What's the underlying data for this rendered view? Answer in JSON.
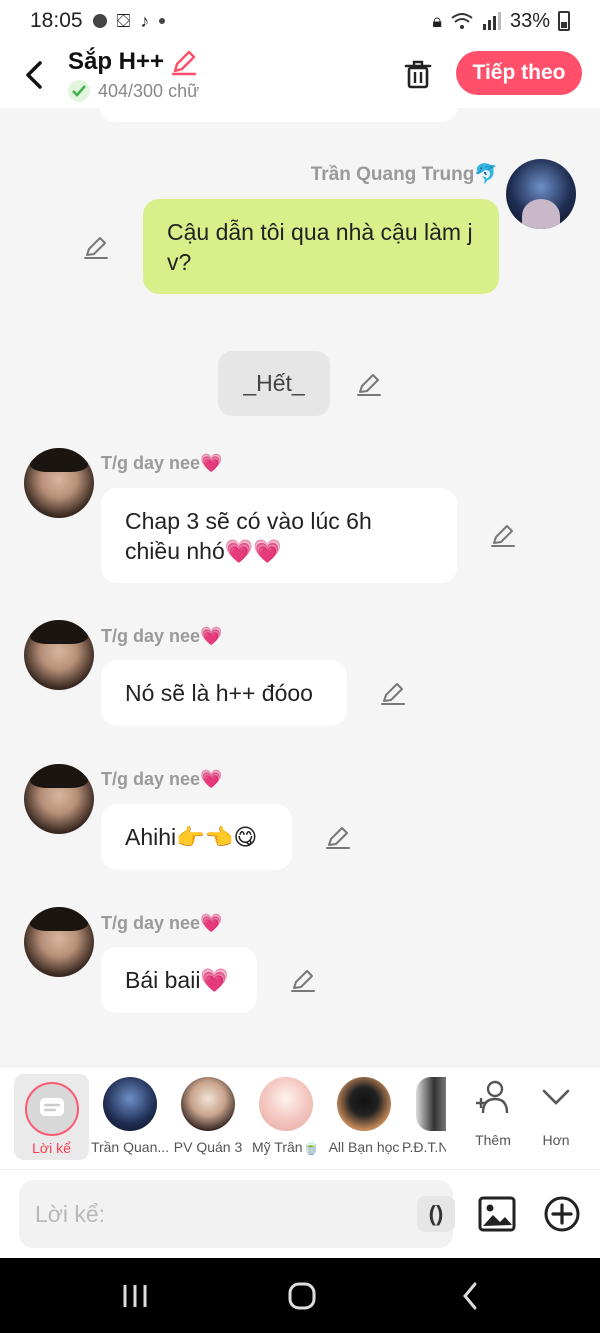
{
  "status_bar": {
    "time": "18:05",
    "battery": "33%"
  },
  "header": {
    "title": "Sắp H++",
    "word_count": "404/300 chữ",
    "next_label": "Tiếp theo"
  },
  "chat": {
    "right_message": {
      "name": "Trần Quang Trung🐬",
      "text": "Cậu dẫn tôi qua nhà cậu làm j v?"
    },
    "end_marker": "_Hết_",
    "left_messages": [
      {
        "name": "T/g day nee💗",
        "text": "Chap 3 sẽ có vào lúc 6h chiều nhó💗💗"
      },
      {
        "name": "T/g day nee💗",
        "text": "Nó sẽ là h++ đóoo"
      },
      {
        "name": "T/g day nee💗",
        "text": "Ahihi👉👈😋"
      },
      {
        "name": "T/g day nee💗",
        "text": "Bái baii💗"
      }
    ]
  },
  "characters": {
    "narrator_label": "Lời kể",
    "items": [
      {
        "label": "Trần Quan...",
        "color": "#1f2d52"
      },
      {
        "label": "PV Quán 3",
        "color": "#6b4a3a"
      },
      {
        "label": "Mỹ Trân🍵",
        "color": "#f3c7c0"
      },
      {
        "label": "All Bạn học",
        "color": "#8a5a3a"
      },
      {
        "label": "P.Đ.T.N",
        "color": "#555555"
      }
    ],
    "add_label": "Thêm",
    "more_label": "Hơn"
  },
  "input": {
    "placeholder": "Lời kể:",
    "paren_label": "()"
  },
  "colors": {
    "accent": "#ff4f6a",
    "right_bubble": "#d9f08a"
  }
}
